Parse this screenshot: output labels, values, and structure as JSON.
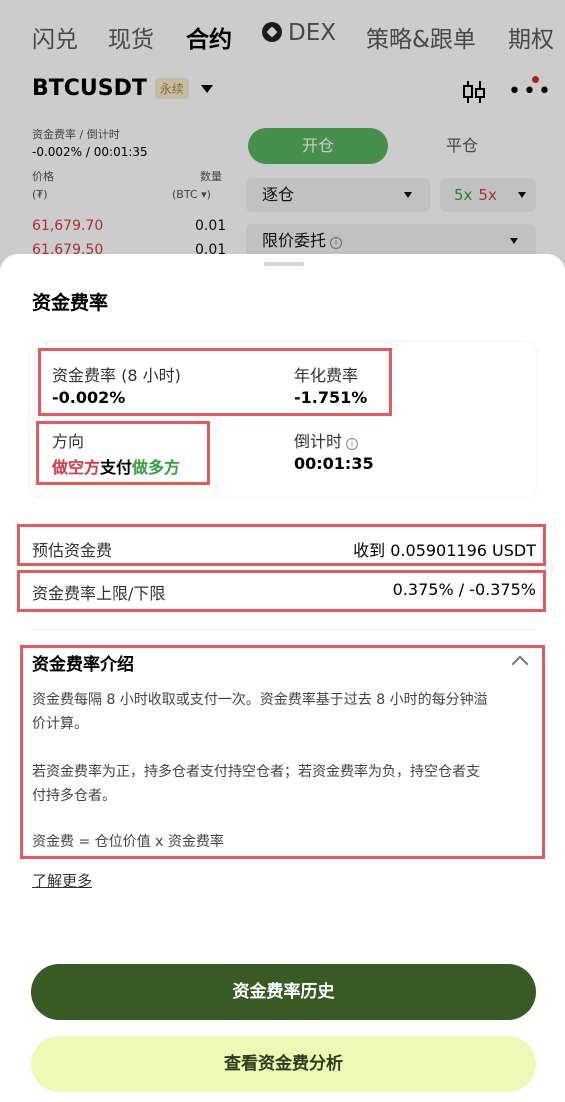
{
  "nav": {
    "items": [
      "闪兑",
      "现货",
      "合约",
      "DEX",
      "策略&跟单",
      "期权"
    ],
    "active_index": 2
  },
  "market": {
    "symbol": "BTCUSDT",
    "perp_badge": "永续",
    "funding_label": "资金费率 / 倒计时",
    "funding_value": "-0.002% / 00:01:35",
    "price_header": "价格",
    "price_unit": "(₮)",
    "qty_header": "数量",
    "qty_unit": "(BTC ▾)",
    "orderbook": [
      {
        "price": "61,679.70",
        "qty": "0.01"
      },
      {
        "price": "61,679.50",
        "qty": "0.01"
      }
    ]
  },
  "order_panel": {
    "open_tab": "开仓",
    "close_tab": "平仓",
    "margin_mode": "逐仓",
    "leverage_long": "5x",
    "leverage_short": "5x",
    "order_type": "限价委托"
  },
  "sheet": {
    "title": "资金费率",
    "funding_rate_label": "资金费率 (8 小时)",
    "funding_rate_value": "-0.002%",
    "annual_rate_label": "年化费率",
    "annual_rate_value": "-1.751%",
    "direction_label": "方向",
    "direction_short": "做空方",
    "direction_pay": "支付",
    "direction_long": "做多方",
    "countdown_label": "倒计时",
    "countdown_value": "00:01:35",
    "estimated_fee_label": "预估资金费",
    "estimated_fee_value": "收到 0.05901196 USDT",
    "limit_label": "资金费率上限/下限",
    "limit_value": "0.375% / -0.375%",
    "intro_title": "资金费率介绍",
    "intro_p1_line1": "资金费每隔 8 小时收取或支付一次。资金费率基于过去 8 小时的每分钟溢",
    "intro_p1_line2": "价计算。",
    "intro_p2_line1": "若资金费率为正，持多仓者支付持空仓者；若资金费率为负，持空仓者支",
    "intro_p2_line2": "付持多仓者。",
    "intro_p3": "资金费 = 仓位价值 x 资金费率",
    "learn_more": "了解更多",
    "history_button": "资金费率历史",
    "analysis_button": "查看资金费分析"
  },
  "colors": {
    "green_accent": "#58b35f",
    "long_green": "#37a03f",
    "short_red": "#d23b4b",
    "primary_button": "#385a24",
    "secondary_button": "#eef9b6",
    "highlight_box": "#e25960"
  }
}
